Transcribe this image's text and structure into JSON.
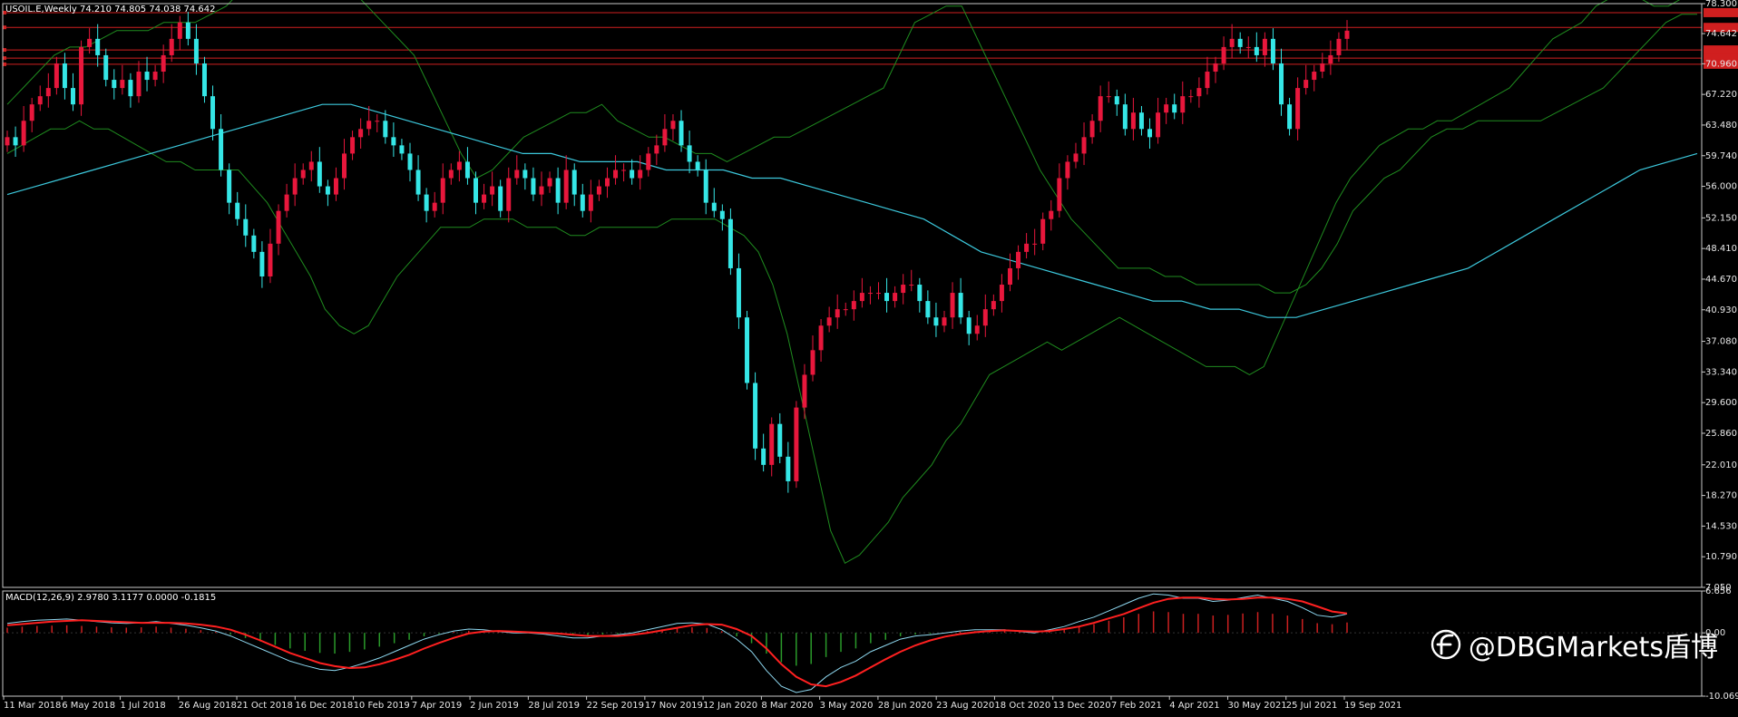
{
  "main_title": "USOIL.E,Weekly  74.210 74.805 74.038 74.642",
  "macd_title": "MACD(12,26,9) 2.9780 3.1177 0.0000 -0.1815",
  "watermark": "@DBGMarkets盾博",
  "colors": {
    "background": "#000000",
    "bull_candle": "#e8173c",
    "bear_candle": "#35e6e6",
    "bollinger": "#1f8c1f",
    "moving_average": "#3cc8dc",
    "level_lines": "#d01f1f",
    "macd_signal": "#ff2020",
    "macd_line": "#8ed8f0",
    "hist_pos": "#cc2020",
    "hist_neg": "#2a9a2a",
    "axis": "#c8c8c8"
  },
  "chart_data": [
    {
      "type": "candlestick",
      "title": "USOIL.E,Weekly",
      "ylim": [
        7.05,
        78.3
      ],
      "y_ticks": [
        "78.300",
        "74.642",
        "70.960",
        "67.220",
        "63.480",
        "59.740",
        "56.000",
        "52.150",
        "48.410",
        "44.670",
        "40.930",
        "37.080",
        "33.340",
        "29.600",
        "25.860",
        "22.010",
        "18.270",
        "14.530",
        "10.790",
        "7.050"
      ],
      "y_tick_values": [
        78.3,
        74.642,
        70.96,
        67.22,
        63.48,
        59.74,
        56.0,
        52.15,
        48.41,
        44.67,
        40.93,
        37.08,
        33.34,
        29.6,
        25.86,
        22.01,
        18.27,
        14.53,
        10.79,
        7.05
      ],
      "x_ticks": [
        "11 Mar 2018",
        "6 May 2018",
        "1 Jul 2018",
        "26 Aug 2018",
        "21 Oct 2018",
        "16 Dec 2018",
        "10 Feb 2019",
        "7 Apr 2019",
        "2 Jun 2019",
        "28 Jul 2019",
        "22 Sep 2019",
        "17 Nov 2019",
        "12 Jan 2020",
        "8 Mar 2020",
        "3 May 2020",
        "28 Jun 2020",
        "23 Aug 2020",
        "18 Oct 2020",
        "13 Dec 2020",
        "7 Feb 2021",
        "4 Apr 2021",
        "30 May 2021",
        "25 Jul 2021",
        "19 Sep 2021"
      ],
      "close_path": [
        62,
        61,
        64,
        66,
        67,
        68,
        71,
        68,
        66,
        73,
        74,
        72,
        69,
        68,
        69,
        67,
        70,
        69,
        70,
        72,
        74,
        76,
        74,
        71,
        67,
        63,
        58,
        54,
        52,
        50,
        48,
        45,
        49,
        53,
        55,
        57,
        58,
        59,
        56,
        55,
        57,
        60,
        62,
        63,
        64,
        64,
        62,
        61,
        60,
        58,
        55,
        53,
        54,
        57,
        58,
        59,
        57,
        54,
        55,
        56,
        53,
        57,
        58,
        57,
        55,
        56,
        57,
        54,
        58,
        55,
        53,
        55,
        56,
        57,
        58,
        58,
        57,
        58,
        60,
        61,
        63,
        64,
        61,
        59,
        58,
        54,
        53,
        52,
        46,
        40,
        32,
        24,
        22,
        27,
        23,
        20,
        29,
        33,
        36,
        39,
        40,
        41,
        41,
        42,
        43,
        43,
        43,
        42,
        43,
        44,
        44,
        42,
        40,
        39,
        40,
        43,
        40,
        38,
        39,
        41,
        42,
        44,
        46,
        48,
        49,
        49,
        52,
        53,
        57,
        59,
        60,
        62,
        64,
        67,
        67,
        66,
        63,
        65,
        63,
        62,
        65,
        66,
        65,
        67,
        67,
        68,
        70,
        71,
        73,
        74,
        73,
        73,
        72,
        74,
        71,
        66,
        63,
        68,
        69,
        70,
        71,
        72,
        74,
        75
      ],
      "bollinger_upper": [
        66,
        68,
        70,
        72,
        73,
        73,
        74,
        75,
        75,
        75,
        76,
        76,
        76,
        77,
        78,
        80,
        83,
        86,
        86,
        86,
        84,
        82,
        80,
        78,
        76,
        74,
        72,
        68,
        64,
        60,
        57,
        58,
        60,
        62,
        63,
        64,
        65,
        65,
        66,
        64,
        63,
        62,
        62,
        61,
        60,
        60,
        59,
        60,
        61,
        62,
        62,
        63,
        64,
        65,
        66,
        67,
        68,
        72,
        76,
        77,
        78,
        78,
        74,
        70,
        66,
        62,
        58,
        55,
        52,
        50,
        48,
        46,
        46,
        46,
        45,
        45,
        44,
        44,
        44,
        44,
        44,
        43,
        43,
        44,
        46,
        49,
        53,
        55,
        57,
        58,
        60,
        62,
        63,
        63,
        64,
        64,
        64,
        64,
        64,
        65,
        66,
        67,
        68,
        70,
        72,
        74,
        76,
        77,
        77
      ],
      "bollinger_lower": [
        60,
        61,
        62,
        63,
        63,
        64,
        63,
        63,
        62,
        61,
        60,
        59,
        59,
        58,
        58,
        58,
        58,
        56,
        54,
        51,
        48,
        45,
        41,
        39,
        38,
        39,
        42,
        45,
        47,
        49,
        51,
        51,
        51,
        52,
        52,
        52,
        51,
        51,
        51,
        50,
        50,
        51,
        51,
        51,
        51,
        51,
        52,
        52,
        52,
        52,
        51,
        50,
        48,
        44,
        38,
        30,
        22,
        14,
        10,
        11,
        13,
        15,
        18,
        20,
        22,
        25,
        27,
        30,
        33,
        34,
        35,
        36,
        37,
        36,
        37,
        38,
        39,
        40,
        39,
        38,
        37,
        36,
        35,
        34,
        34,
        34,
        33,
        34,
        38,
        42,
        46,
        50,
        54,
        57,
        59,
        61,
        62,
        63,
        63,
        64,
        64,
        65,
        66,
        67,
        68,
        70,
        72,
        74,
        75,
        76,
        78,
        79,
        80,
        79,
        78,
        78,
        79,
        80
      ],
      "moving_average": [
        55,
        56,
        57,
        58,
        59,
        60,
        61,
        62,
        63,
        64,
        65,
        66,
        66,
        65,
        64,
        63,
        62,
        61,
        60,
        60,
        59,
        59,
        59,
        58,
        58,
        58,
        57,
        57,
        56,
        55,
        54,
        53,
        52,
        50,
        48,
        47,
        46,
        45,
        44,
        43,
        42,
        42,
        41,
        41,
        40,
        40,
        41,
        42,
        43,
        44,
        45,
        46,
        48,
        50,
        52,
        54,
        56,
        58,
        59,
        60
      ],
      "levels": [
        77.2,
        75.4,
        72.65,
        71.65,
        70.9
      ]
    },
    {
      "type": "macd",
      "title": "MACD(12,26,9)",
      "ylim": [
        -10.0699,
        6.656
      ],
      "y_ticks": [
        "6.656",
        "0.00",
        "-10.0699"
      ],
      "y_tick_values": [
        6.656,
        0,
        -10.0699
      ],
      "macd_line": [
        1.5,
        1.8,
        2.0,
        2.1,
        2.2,
        2.0,
        1.8,
        1.6,
        1.5,
        1.6,
        1.8,
        1.5,
        1.2,
        0.8,
        0.3,
        -0.5,
        -1.5,
        -2.5,
        -3.5,
        -4.5,
        -5.2,
        -5.8,
        -6.0,
        -5.5,
        -4.8,
        -4.0,
        -3.0,
        -2.0,
        -1.0,
        -0.3,
        0.3,
        0.6,
        0.5,
        0.2,
        0,
        0,
        -0.2,
        -0.5,
        -0.8,
        -0.8,
        -0.5,
        -0.3,
        0,
        0.5,
        1.0,
        1.5,
        1.6,
        1.4,
        0.5,
        -1.0,
        -3.0,
        -6.0,
        -8.5,
        -9.5,
        -9.0,
        -7.0,
        -5.5,
        -4.5,
        -3.0,
        -2.0,
        -1.0,
        -0.5,
        -0.3,
        0,
        0.3,
        0.5,
        0.5,
        0.5,
        0.2,
        0,
        0.5,
        1.0,
        1.8,
        2.5,
        3.5,
        4.5,
        5.5,
        6.2,
        6.0,
        5.5,
        5.5,
        5.0,
        5.2,
        5.6,
        6.0,
        5.5,
        5.0,
        4.0,
        2.8,
        2.5,
        3.0
      ],
      "signal_line": [
        1.2,
        1.4,
        1.6,
        1.8,
        1.9,
        2.0,
        1.9,
        1.8,
        1.7,
        1.6,
        1.6,
        1.6,
        1.5,
        1.3,
        1.0,
        0.5,
        -0.3,
        -1.2,
        -2.2,
        -3.2,
        -4.0,
        -4.8,
        -5.3,
        -5.6,
        -5.5,
        -5.0,
        -4.3,
        -3.5,
        -2.5,
        -1.6,
        -0.8,
        -0.1,
        0.2,
        0.3,
        0.2,
        0.1,
        0,
        -0.1,
        -0.3,
        -0.5,
        -0.5,
        -0.5,
        -0.3,
        0,
        0.4,
        0.8,
        1.2,
        1.4,
        1.3,
        0.6,
        -0.5,
        -2.5,
        -5.0,
        -7.0,
        -8.2,
        -8.5,
        -7.8,
        -6.8,
        -5.5,
        -4.2,
        -3.0,
        -2.0,
        -1.2,
        -0.6,
        -0.2,
        0.1,
        0.3,
        0.4,
        0.3,
        0.2,
        0.3,
        0.6,
        1.0,
        1.6,
        2.3,
        3.0,
        3.9,
        4.8,
        5.4,
        5.6,
        5.6,
        5.4,
        5.3,
        5.4,
        5.6,
        5.6,
        5.4,
        5.0,
        4.2,
        3.4,
        3.1
      ]
    }
  ]
}
